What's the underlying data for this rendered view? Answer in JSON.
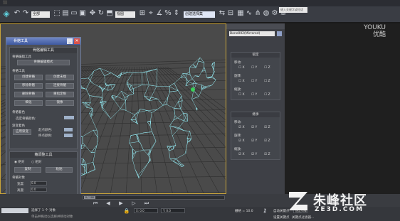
{
  "watermarks": {
    "youku_line1": "YOUKU",
    "youku_line2": "优酷",
    "site_name": "朱峰社区",
    "site_domain": "ZE3D.COM"
  },
  "toolbar": {
    "filter_combo": "全部",
    "view_combo": "视图",
    "selection_set_combo": "创建选择集",
    "search_placeholder": "键入关键字或短语"
  },
  "dialog": {
    "title": "骨骼工具",
    "section1_title": "骨骼编辑工具",
    "edit_mode_button": "骨骼编辑模式",
    "bone_edit_label": "骨骼编辑工具",
    "bone_tools_label": "骨骼工具",
    "buttons": [
      "创建骨骼",
      "创建末端",
      "移除骨骼",
      "连接骨骼",
      "删除骨骼",
      "重指定根",
      "细化",
      "镜像"
    ],
    "bone_color_label": "骨骼着色",
    "selected_color_label": "选定骨骼颜色:",
    "gradient_label": "渐变着色",
    "apply_gradient_button": "应用渐变",
    "start_color_label": "起点颜色:",
    "end_color_label": "终点颜色:",
    "section2_title": "鳍调整工具",
    "radio_absolute": "绝对",
    "radio_relative": "相对",
    "copy_button": "复制",
    "paste_button": "粘贴",
    "bone_object_label": "骨骼对象",
    "fields": [
      {
        "label": "宽度:",
        "value": "0.0"
      },
      {
        "label": "高度:",
        "value": "0.0"
      },
      {
        "label": "锥化:",
        "value": "0.0"
      }
    ]
  },
  "command_panel": {
    "object_name": "Bone002(Mirrored)",
    "rollout1_title": "锁定",
    "rollout1_groups": [
      "移动:",
      "旋转:",
      "缩放:"
    ],
    "rollout2_title": "继承",
    "rollout2_groups": [
      "移动:",
      "旋转:",
      "缩放:"
    ],
    "axes": [
      "X",
      "Y",
      "Z"
    ]
  },
  "status": {
    "selection_text": "选择了 1 个 对象",
    "prompt_text": "单击并拖动以选择并移动对象",
    "x_value": "X: 0.0",
    "y_value": "Y: 0.0",
    "grid_text": "栅格 = 10.0",
    "autokey_label": "自动关键点",
    "selected_object_label": "选定对象",
    "set_key_label": "设置关键点",
    "key_filter_label": "关键点过滤器..."
  },
  "timeline": {
    "frame_readout": "0 / 100"
  }
}
